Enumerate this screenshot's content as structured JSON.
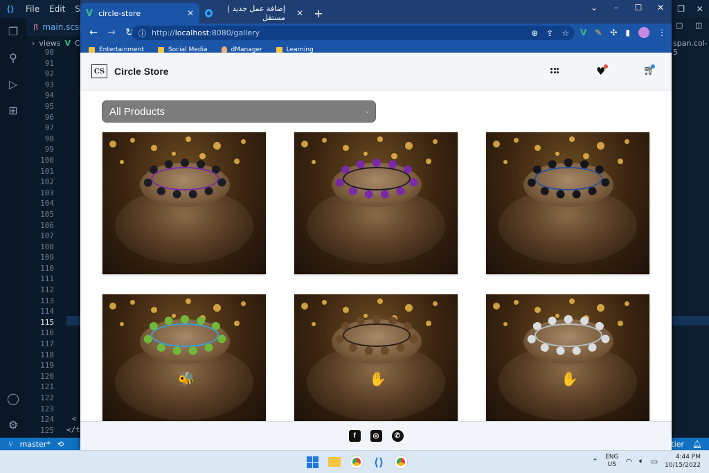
{
  "vscode": {
    "menu": [
      "File",
      "Edit",
      "Sele"
    ],
    "tab_label": "main.scss",
    "breadcrumb": [
      "views",
      "Ca"
    ],
    "line_numbers": [
      "90",
      "91",
      "92",
      "93",
      "94",
      "95",
      "96",
      "97",
      "98",
      "99",
      "100",
      "101",
      "102",
      "103",
      "104",
      "105",
      "106",
      "107",
      "108",
      "109",
      "110",
      "111",
      "112",
      "113",
      "114",
      "115",
      "116",
      "117",
      "118",
      "119",
      "120",
      "121",
      "122",
      "123",
      "124",
      "125"
    ],
    "current_line": "115",
    "right_tab_text": "span.col-5",
    "status_branch": "master*",
    "status_right": "ttier"
  },
  "browser": {
    "tabs": [
      {
        "label": "circle-store",
        "active": true
      },
      {
        "label": "إضافة عمل جديد | مستقل",
        "active": false
      }
    ],
    "url_host": "localhost",
    "url_prefix": "http://",
    "url_rest": ":8080/gallery",
    "bookmarks": [
      "Entertainment",
      "Social Media",
      "dManager",
      "Learning"
    ]
  },
  "site": {
    "brand_logo_text": "CS",
    "brand_name": "Circle Store",
    "filter_selected": "All Products",
    "products": [
      {
        "bead_color": "#1b1b24",
        "accent": "#7b2aa8"
      },
      {
        "bead_color": "#7a2aa8",
        "accent": "#1b1b24"
      },
      {
        "bead_color": "#15151d",
        "accent": "#2a4f9a"
      },
      {
        "bead_color": "#6fb83a",
        "accent": "#3aa0d8",
        "charm": "🐝"
      },
      {
        "bead_color": "#6b4a2a",
        "accent": "#2a1c12",
        "charm": "✋"
      },
      {
        "bead_color": "#d9dde0",
        "accent": "#b9c0c4",
        "charm": "✋"
      }
    ]
  },
  "taskbar": {
    "lang_line1": "ENG",
    "lang_line2": "US",
    "time": "4:44 PM",
    "date": "10/15/2022"
  },
  "colors": {
    "vscode_bg": "#0b1a2b",
    "chrome_frame": "#1a55a8",
    "filter_bg": "#7c7c7c",
    "status_bar": "#1172c4"
  }
}
